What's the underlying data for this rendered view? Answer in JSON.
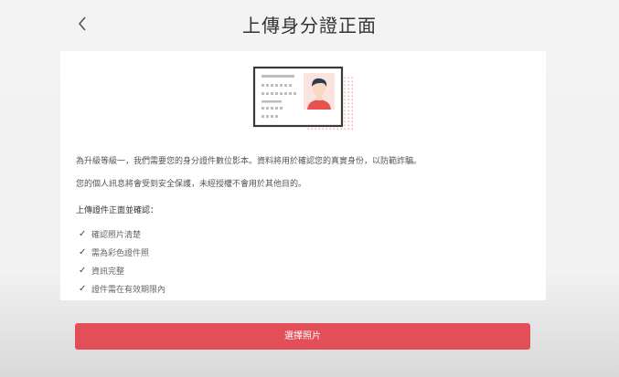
{
  "header": {
    "title": "上傳身分證正面",
    "back_icon": "chevron-left-icon"
  },
  "illustration": {
    "icon": "id-card-illustration",
    "accent_color": "#e8524f"
  },
  "content": {
    "paragraph1": "為升級等級一，我們需要您的身分證件數位影本。資料將用於確認您的真實身份，以防範詐騙。",
    "paragraph2": "您的個人訊息將會受到安全保護，未經授權不會用於其他目的。",
    "section_title": "上傳證件正面並確認：",
    "checklist": [
      "確認照片清楚",
      "需為彩色證件照",
      "資訊完整",
      "證件需在有效期限內"
    ],
    "check_symbol": "✓"
  },
  "footer": {
    "primary_button": "選擇照片",
    "button_color": "#e24f58"
  }
}
